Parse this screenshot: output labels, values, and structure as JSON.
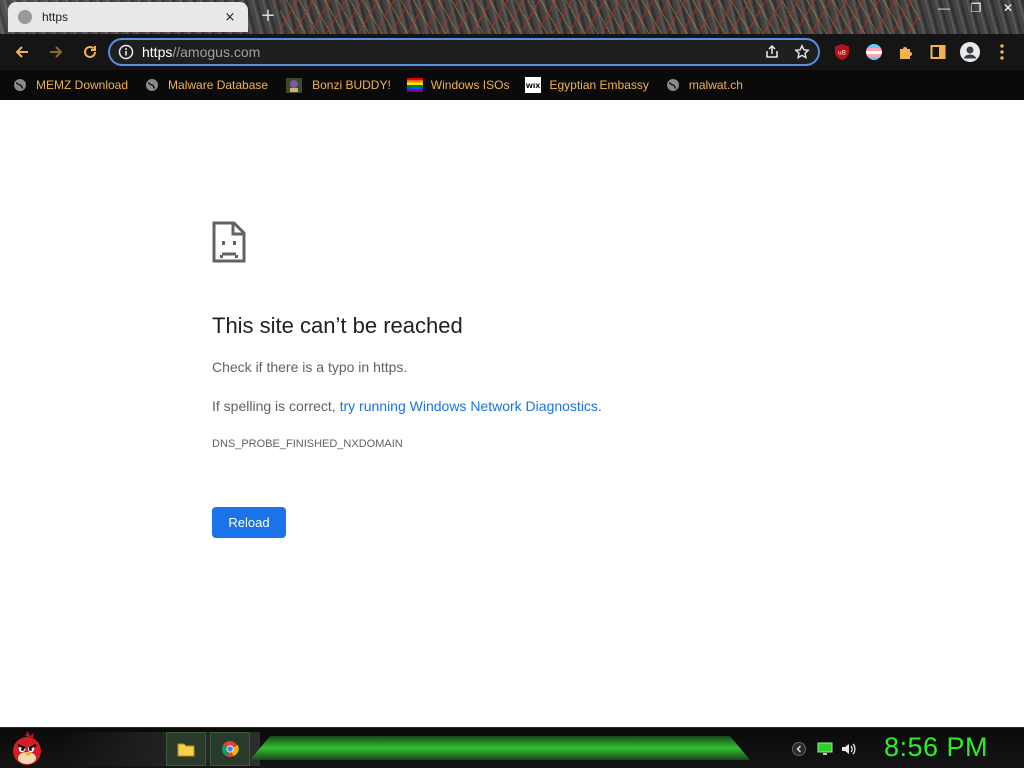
{
  "browser": {
    "tab": {
      "title": "https",
      "close_glyph": "×",
      "favicon": "globe-icon"
    },
    "new_tab_glyph": "+",
    "window_controls": {
      "minimize": "—",
      "maximize": "❐",
      "close": "✕"
    },
    "omnibox": {
      "scheme": "https",
      "rest": "//amogus.com"
    },
    "bookmarks": [
      {
        "label": "MEMZ Download",
        "icon": "globe-icon"
      },
      {
        "label": "Malware Database",
        "icon": "globe-icon"
      },
      {
        "label": "Bonzi BUDDY!",
        "icon": "bonzi-icon"
      },
      {
        "label": "Windows ISOs",
        "icon": "rainbow-flag-icon"
      },
      {
        "label": "Egyptian Embassy",
        "icon": "wix-icon"
      },
      {
        "label": "malwat.ch",
        "icon": "globe-icon"
      }
    ],
    "wix_badge": "WIX",
    "ublock_badge": "uB"
  },
  "error_page": {
    "title": "This site can’t be reached",
    "line1": "Check if there is a typo in https.",
    "line2_prefix": "If spelling is correct, ",
    "line2_link": "try running Windows Network Diagnostics",
    "line2_suffix": ".",
    "code": "DNS_PROBE_FINISHED_NXDOMAIN",
    "reload_label": "Reload"
  },
  "taskbar": {
    "clock": "8:56 PM"
  },
  "colors": {
    "accent": "#1a73e8",
    "omnibox_border": "#5a8fe0",
    "bookmark_text": "#f2b24c",
    "clock": "#27f027"
  }
}
